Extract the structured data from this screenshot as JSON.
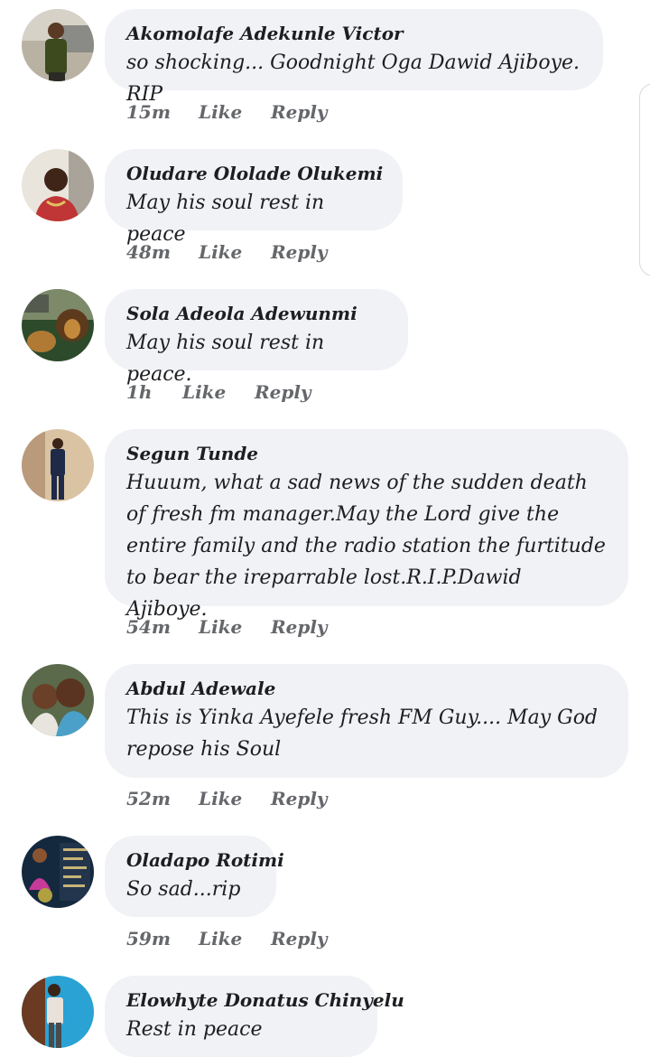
{
  "comments": [
    {
      "name": "Akomolafe Adekunle Victor",
      "text": "so shocking... Goodnight Oga Dawid Ajiboye. RIP",
      "time": "15m",
      "like": "Like",
      "reply": "Reply"
    },
    {
      "name": "Oludare Ololade Olukemi",
      "text": "May his soul rest in peace",
      "time": "48m",
      "like": "Like",
      "reply": "Reply"
    },
    {
      "name": "Sola Adeola Adewunmi",
      "text": "May his soul rest in peace.",
      "time": "1h",
      "like": "Like",
      "reply": "Reply"
    },
    {
      "name": "Segun Tunde",
      "text": "Huuum, what a sad news of the sudden death of fresh fm manager.May the Lord give the entire family and the radio station the furtitude to bear the ireparrable lost.R.I.P.Dawid Ajiboye.",
      "time": "54m",
      "like": "Like",
      "reply": "Reply"
    },
    {
      "name": "Abdul Adewale",
      "text": "This is Yinka Ayefele fresh FM Guy.... May God repose his Soul",
      "time": "52m",
      "like": "Like",
      "reply": "Reply"
    },
    {
      "name": "Oladapo Rotimi",
      "text": "So sad...rip",
      "time": "59m",
      "like": "Like",
      "reply": "Reply"
    },
    {
      "name": "Elowhyte Donatus Chinyelu",
      "text": "Rest in peace"
    }
  ],
  "colors": {
    "bubble": "#f0f2f5",
    "meta": "#65676b",
    "text": "#1c1e21"
  }
}
